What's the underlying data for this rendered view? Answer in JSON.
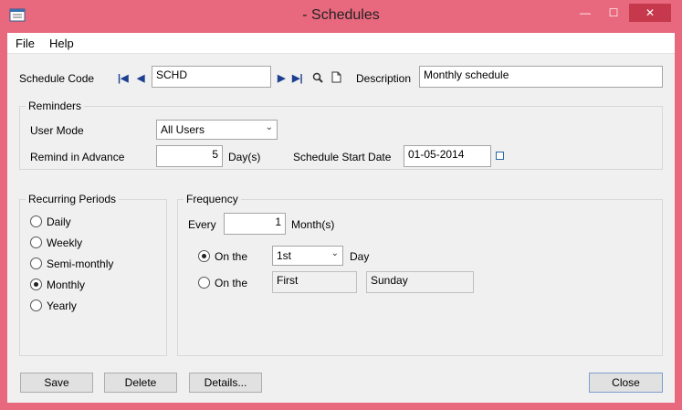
{
  "window": {
    "title": "- Schedules",
    "controls": {
      "minimize": "—",
      "maximize": "☐",
      "close": "✕"
    }
  },
  "menu": [
    "File",
    "Help"
  ],
  "schedule": {
    "code_label": "Schedule Code",
    "code_value": "SCHD",
    "description_label": "Description",
    "description_value": "Monthly schedule"
  },
  "reminders": {
    "title": "Reminders",
    "user_mode_label": "User Mode",
    "user_mode_value": "All Users",
    "remind_label": "Remind in Advance",
    "remind_value": "5",
    "days_unit": "Day(s)",
    "start_date_label": "Schedule Start Date",
    "start_date_value": "01-05-2014"
  },
  "recurring": {
    "title": "Recurring Periods",
    "options": [
      "Daily",
      "Weekly",
      "Semi-monthly",
      "Monthly",
      "Yearly"
    ],
    "selected": "Monthly"
  },
  "frequency": {
    "title": "Frequency",
    "every_label": "Every",
    "every_value": "1",
    "every_unit": "Month(s)",
    "on_the_label": "On the",
    "day_value": "1st",
    "day_unit": "Day",
    "week_value": "First",
    "weekday_value": "Sunday"
  },
  "buttons": {
    "save": "Save",
    "delete": "Delete",
    "details": "Details...",
    "close": "Close"
  }
}
